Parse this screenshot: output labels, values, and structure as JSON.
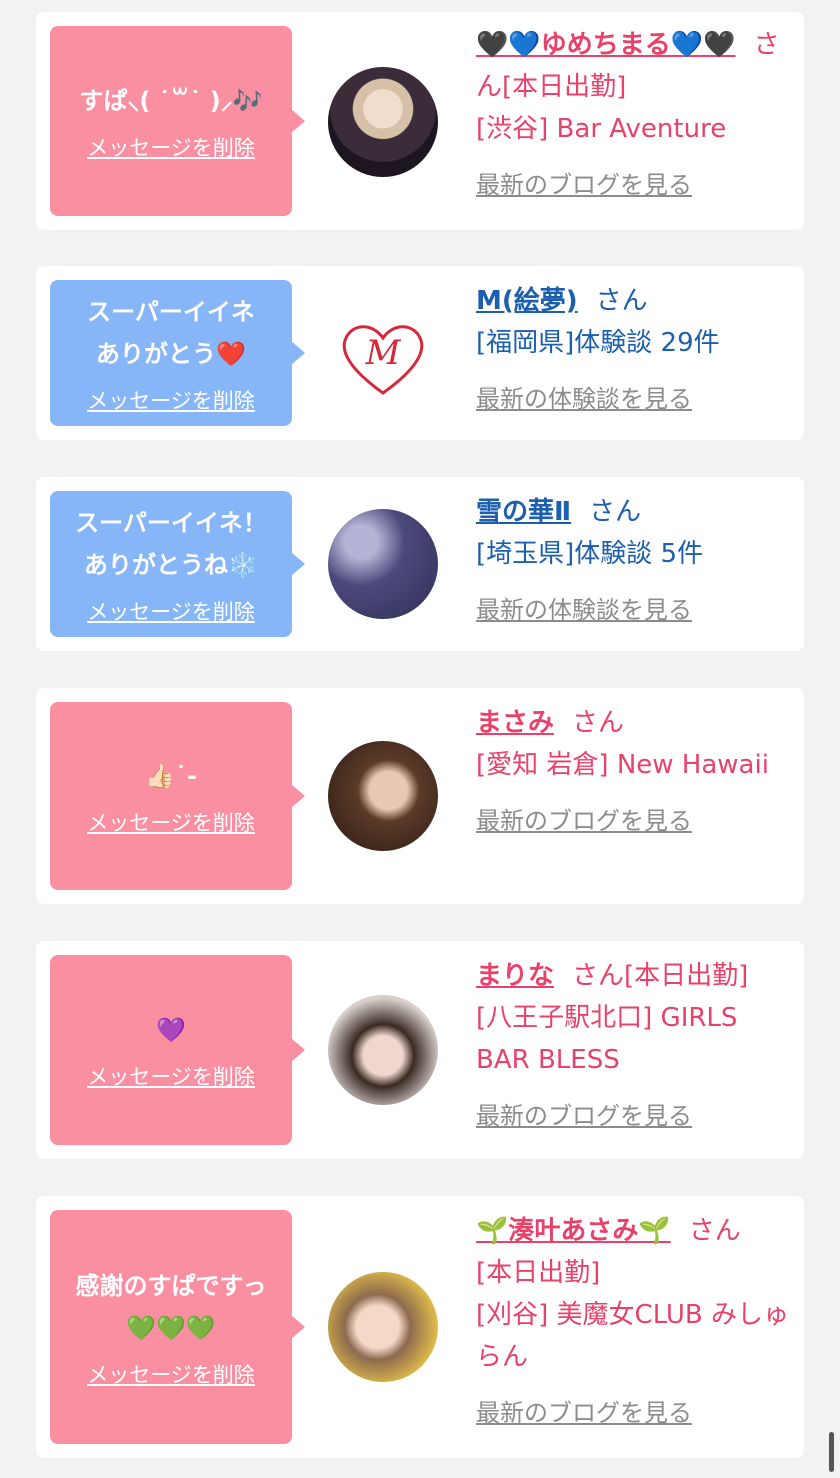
{
  "cards": [
    {
      "message": "すぱ⸜( ˙꒳˙ )⸝🎶",
      "delete_label": "メッセージを削除",
      "name": "🖤💙ゆめちまる💙🖤",
      "suffix": "さん[本日出勤]",
      "details": [
        "[渋谷] Bar Aventure"
      ],
      "link": "最新のブログを見る",
      "avatar_icon": "profile-photo",
      "bubble_color": "#fb8fa2",
      "text_color": "#e8416a"
    },
    {
      "message": "スーパーイイネ\nありがとう❤️",
      "delete_label": "メッセージを削除",
      "name": "M(絵夢)",
      "suffix": "さん",
      "details": [
        "[福岡県]体験談 29件"
      ],
      "link": "最新の体験談を見る",
      "avatar_icon": "heart-m-logo",
      "avatar_logo_letter": "M",
      "bubble_color": "#86b6f7",
      "text_color": "#1b5fae"
    },
    {
      "message": "スーパーイイネ！\nありがとうね❄️",
      "delete_label": "メッセージを削除",
      "name": "雪の華Ⅱ",
      "suffix": "さん",
      "details": [
        "[埼玉県]体験談 5件"
      ],
      "link": "最新の体験談を見る",
      "avatar_icon": "snowflake-photo",
      "bubble_color": "#86b6f7",
      "text_color": "#1b5fae"
    },
    {
      "message": "👍🏻˙-",
      "delete_label": "メッセージを削除",
      "name": "まさみ",
      "suffix": "さん",
      "details": [
        "[愛知 岩倉] New Hawaii"
      ],
      "link": "最新のブログを見る",
      "avatar_icon": "profile-photo",
      "bubble_color": "#fb8fa2",
      "text_color": "#e8416a"
    },
    {
      "message": "💜",
      "delete_label": "メッセージを削除",
      "name": "まりな",
      "suffix": "さん[本日出勤]",
      "details": [
        "[八王子駅北口] GIRLS BAR BLESS"
      ],
      "link": "最新のブログを見る",
      "avatar_icon": "profile-photo",
      "bubble_color": "#fb8fa2",
      "text_color": "#e8416a"
    },
    {
      "message": "感謝のすぱですっ\n💚💚💚",
      "delete_label": "メッセージを削除",
      "name": "🌱湊叶あさみ🌱",
      "suffix": "さん",
      "details": [
        "[本日出勤]",
        "[刈谷] 美魔女CLUB みしゅらん"
      ],
      "link": "最新のブログを見る",
      "avatar_icon": "profile-photo",
      "bubble_color": "#fb8fa2",
      "text_color": "#e8416a"
    }
  ]
}
